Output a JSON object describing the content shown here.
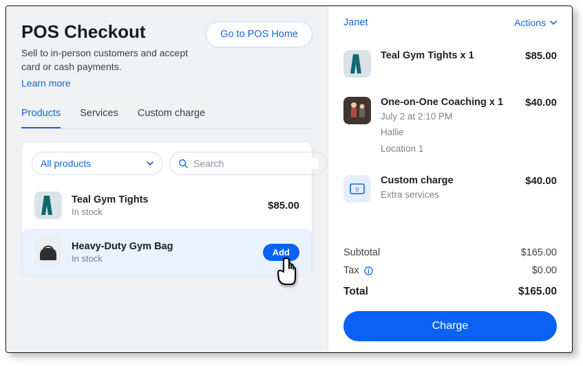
{
  "header": {
    "title": "POS Checkout",
    "subtitle": "Sell to in-person customers and accept card or cash payments.",
    "learn_more": "Learn more",
    "home_button": "Go to POS Home"
  },
  "tabs": {
    "products": "Products",
    "services": "Services",
    "custom": "Custom charge"
  },
  "filter": {
    "label": "All products",
    "search_placeholder": "Search"
  },
  "products": [
    {
      "name": "Teal Gym Tights",
      "stock": "In stock",
      "price": "$85.00"
    },
    {
      "name": "Heavy-Duty Gym Bag",
      "stock": "In stock",
      "add_label": "Add"
    }
  ],
  "customer": {
    "name": "Janet",
    "actions_label": "Actions"
  },
  "cart": [
    {
      "title": "Teal Gym Tights x 1",
      "price": "$85.00"
    },
    {
      "title": "One-on-One Coaching x 1",
      "meta1": "July 2 at 2:10 PM",
      "meta2": "Hallie",
      "meta3": "Location 1",
      "price": "$40.00"
    },
    {
      "title": "Custom charge",
      "meta1": "Extra services",
      "price": "$40.00",
      "badge": "0"
    }
  ],
  "totals": {
    "subtotal_label": "Subtotal",
    "subtotal_value": "$165.00",
    "tax_label": "Tax",
    "tax_value": "$0.00",
    "total_label": "Total",
    "total_value": "$165.00"
  },
  "charge_label": "Charge"
}
